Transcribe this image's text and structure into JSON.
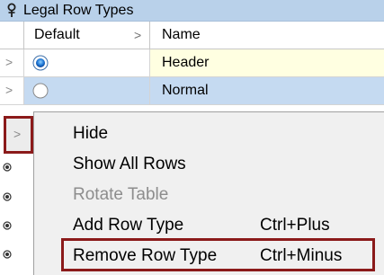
{
  "panel": {
    "title": "Legal Row Types",
    "pin_icon": "pin-icon"
  },
  "grid": {
    "columns": [
      {
        "label": "Default"
      },
      {
        "label": "Name"
      }
    ],
    "rows": [
      {
        "name": "Header",
        "default_selected": true
      },
      {
        "name": "Normal",
        "default_selected": false
      }
    ],
    "colors": {
      "title_bar": "#b9d1ea",
      "header_row_name_bg": "#ffffe1",
      "selected_row_bg": "#c5daf1"
    }
  },
  "context_menu": {
    "items": [
      {
        "label": "Hide",
        "shortcut": "",
        "enabled": true
      },
      {
        "label": "Show All Rows",
        "shortcut": "",
        "enabled": true
      },
      {
        "label": "Rotate Table",
        "shortcut": "",
        "enabled": false
      },
      {
        "label": "Add Row Type",
        "shortcut": "Ctrl+Plus",
        "enabled": true
      },
      {
        "label": "Remove Row Type",
        "shortcut": "Ctrl+Minus",
        "enabled": true
      }
    ],
    "highlight_color": "#8b1a1a"
  }
}
